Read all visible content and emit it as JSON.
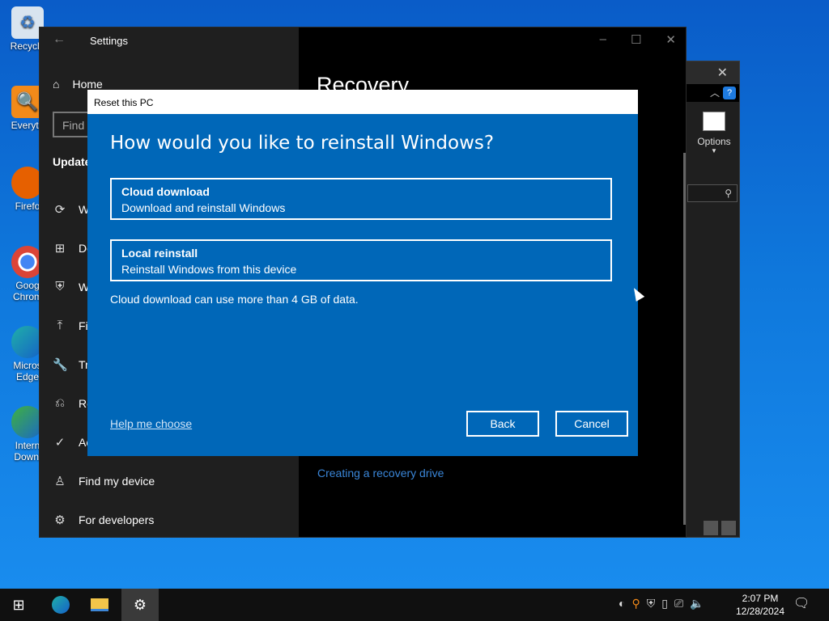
{
  "desktop": {
    "icons": [
      {
        "label": "Recycle",
        "icon": "recycle-bin-icon"
      },
      {
        "label": "Everyth",
        "icon": "everything-search-icon"
      },
      {
        "label": "Firefo",
        "icon": "firefox-icon"
      },
      {
        "label": "Goog",
        "label2": "Chrom",
        "icon": "chrome-icon"
      },
      {
        "label": "Micros",
        "label2": "Edge",
        "icon": "edge-icon"
      },
      {
        "label": "Intern",
        "label2": "Downl",
        "icon": "internet-download-manager-icon"
      }
    ]
  },
  "explorer": {
    "options_label": "Options"
  },
  "settings": {
    "title": "Settings",
    "home_label": "Home",
    "find_placeholder": "Find",
    "section_heading": "Update",
    "nav_items": [
      {
        "label": "W",
        "icon": "sync-icon"
      },
      {
        "label": "De",
        "icon": "delivery-optimization-icon"
      },
      {
        "label": "W",
        "icon": "shield-icon"
      },
      {
        "label": "Fil",
        "icon": "upload-icon"
      },
      {
        "label": "Tr",
        "icon": "wrench-icon"
      },
      {
        "label": "Re",
        "icon": "recovery-icon"
      },
      {
        "label": "Ac",
        "icon": "check-circle-icon"
      },
      {
        "label": "Find my device",
        "icon": "person-locate-icon"
      },
      {
        "label": "For developers",
        "icon": "developer-tools-icon"
      }
    ],
    "page_heading": "Recovery",
    "recovery_link": "Creating a recovery drive"
  },
  "dialog": {
    "title": "Reset this PC",
    "question": "How would you like to reinstall Windows?",
    "options": [
      {
        "title": "Cloud download",
        "description": "Download and reinstall Windows"
      },
      {
        "title": "Local reinstall",
        "description": "Reinstall Windows from this device"
      }
    ],
    "note": "Cloud download can use more than 4 GB of data.",
    "help_link": "Help me choose",
    "back_label": "Back",
    "cancel_label": "Cancel"
  },
  "taskbar": {
    "time": "2:07 PM",
    "date": "12/28/2024"
  },
  "colors": {
    "dialog_bg": "#0067b8",
    "link": "#3a86d8",
    "desktop": "#0f78dc"
  }
}
